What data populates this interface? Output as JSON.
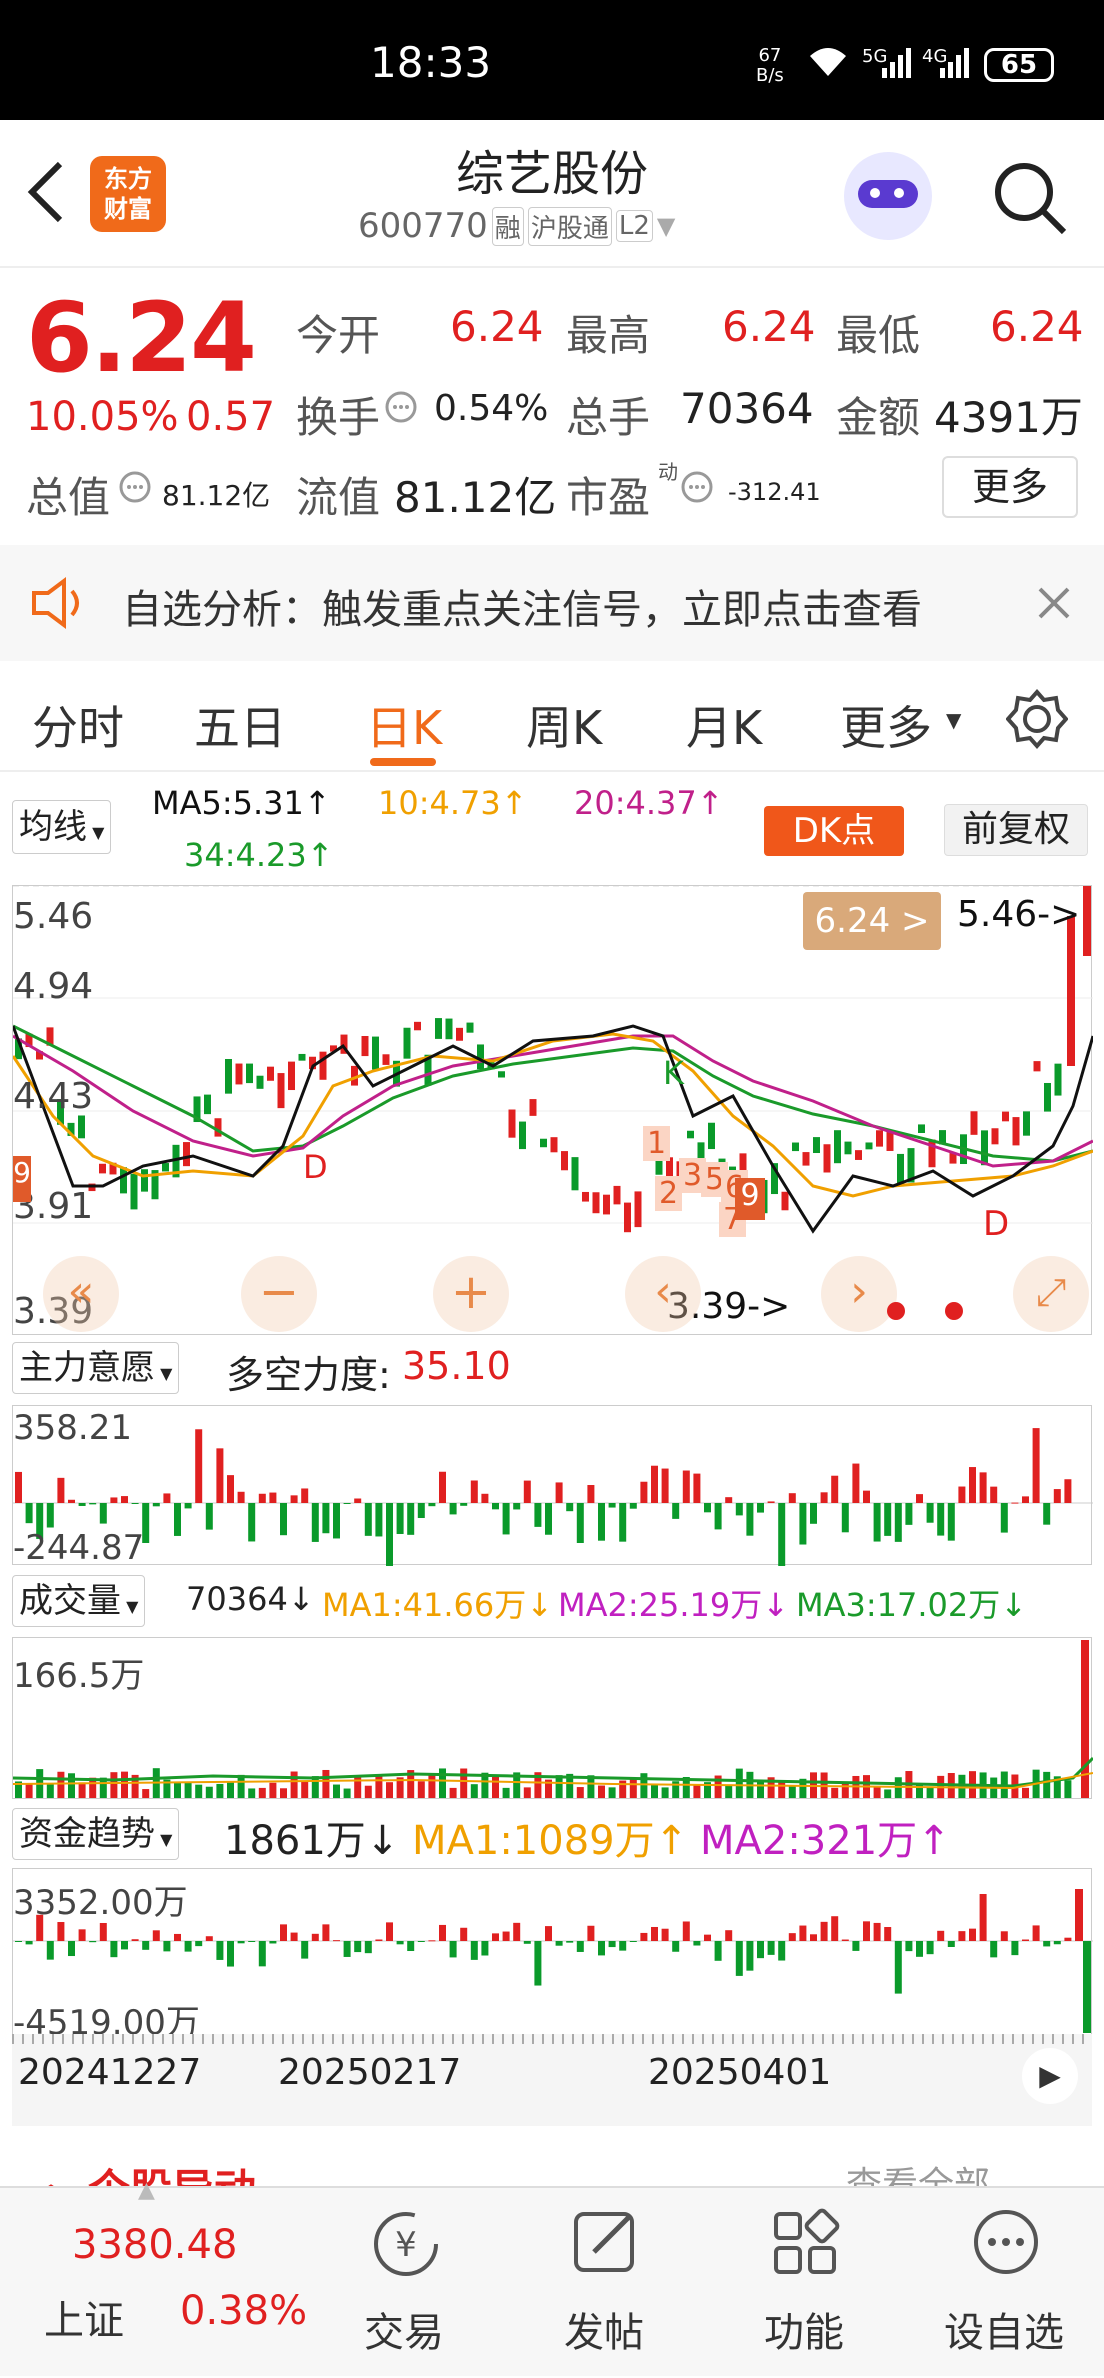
{
  "status": {
    "time": "18:33",
    "net_speed": "67\nB/s",
    "signal1": "5G",
    "signal2": "4G",
    "battery": "65"
  },
  "header": {
    "title": "综艺股份",
    "code": "600770",
    "tags": [
      "融",
      "沪股通",
      "L2"
    ],
    "logo_line1": "东方",
    "logo_line2": "财富"
  },
  "quote": {
    "price": "6.24",
    "pct": "10.05%",
    "change": "0.57",
    "open_label": "今开",
    "open": "6.24",
    "high_label": "最高",
    "high": "6.24",
    "low_label": "最低",
    "low": "6.24",
    "turnover_label": "换手",
    "turnover": "0.54%",
    "vol_label": "总手",
    "vol": "70364",
    "amount_label": "金额",
    "amount": "4391万",
    "mcap_label": "总值",
    "mcap": "81.12亿",
    "float_label": "流值",
    "float": "81.12亿",
    "pe_label": "市盈",
    "pe_sup": "动",
    "pe": "-312.41",
    "more": "更多"
  },
  "notice": {
    "text": "自选分析：触发重点关注信号，立即点击查看"
  },
  "tabs": [
    "分时",
    "五日",
    "日K",
    "周K",
    "月K",
    "更多"
  ],
  "active_tab_index": 2,
  "ma_bar": {
    "selector": "均线",
    "ma5": "MA5:5.31↑",
    "ma10": "10:4.73↑",
    "ma20": "20:4.37↑",
    "ma34": "34:4.23↑",
    "dk": "DK点",
    "fq": "前复权"
  },
  "kline": {
    "y_top": "5.46",
    "y_2": "4.94",
    "y_3": "4.43",
    "y_4": "3.91",
    "y_bottom": "3.39",
    "price_tag": "6.24 >",
    "high_arrow": "5.46->",
    "low_arrow": "3.39->",
    "marks": {
      "k": "K",
      "d1": "D",
      "d2": "D",
      "n1": "1",
      "n2": "2",
      "n3": "3",
      "n4": "5",
      "n5": "6",
      "n6": "7",
      "n7": "9",
      "n8": "9"
    }
  },
  "main_force": {
    "selector": "主力意愿",
    "label": "多空力度:",
    "value": "35.10",
    "top": "358.21",
    "bottom": "-244.87"
  },
  "volume": {
    "selector": "成交量",
    "value": "70364↓",
    "ma1": "MA1:41.66万↓",
    "ma2": "MA2:25.19万↓",
    "ma3": "MA3:17.02万↓",
    "top": "166.5万"
  },
  "fund": {
    "selector": "资金趋势",
    "value": "1861万↓",
    "ma1": "MA1:1089万↑",
    "ma2": "MA2:321万↑",
    "top": "3352.00万",
    "bottom": "-4519.00万"
  },
  "dates": [
    "20241227",
    "20250217",
    "20250401"
  ],
  "peek": {
    "left": "个股异动",
    "right": "查看全部"
  },
  "bottom_nav": {
    "index_value": "3380.48",
    "index_name": "上证",
    "index_pct": "0.38%",
    "items": [
      "交易",
      "发帖",
      "功能",
      "设自选"
    ]
  },
  "colors": {
    "up": "#e02020",
    "down": "#0a9a2a",
    "accent": "#f06a1a",
    "ma5": "#111111",
    "ma10": "#f0a000",
    "ma20": "#c0208a",
    "ma34": "#1a9a2a"
  }
}
